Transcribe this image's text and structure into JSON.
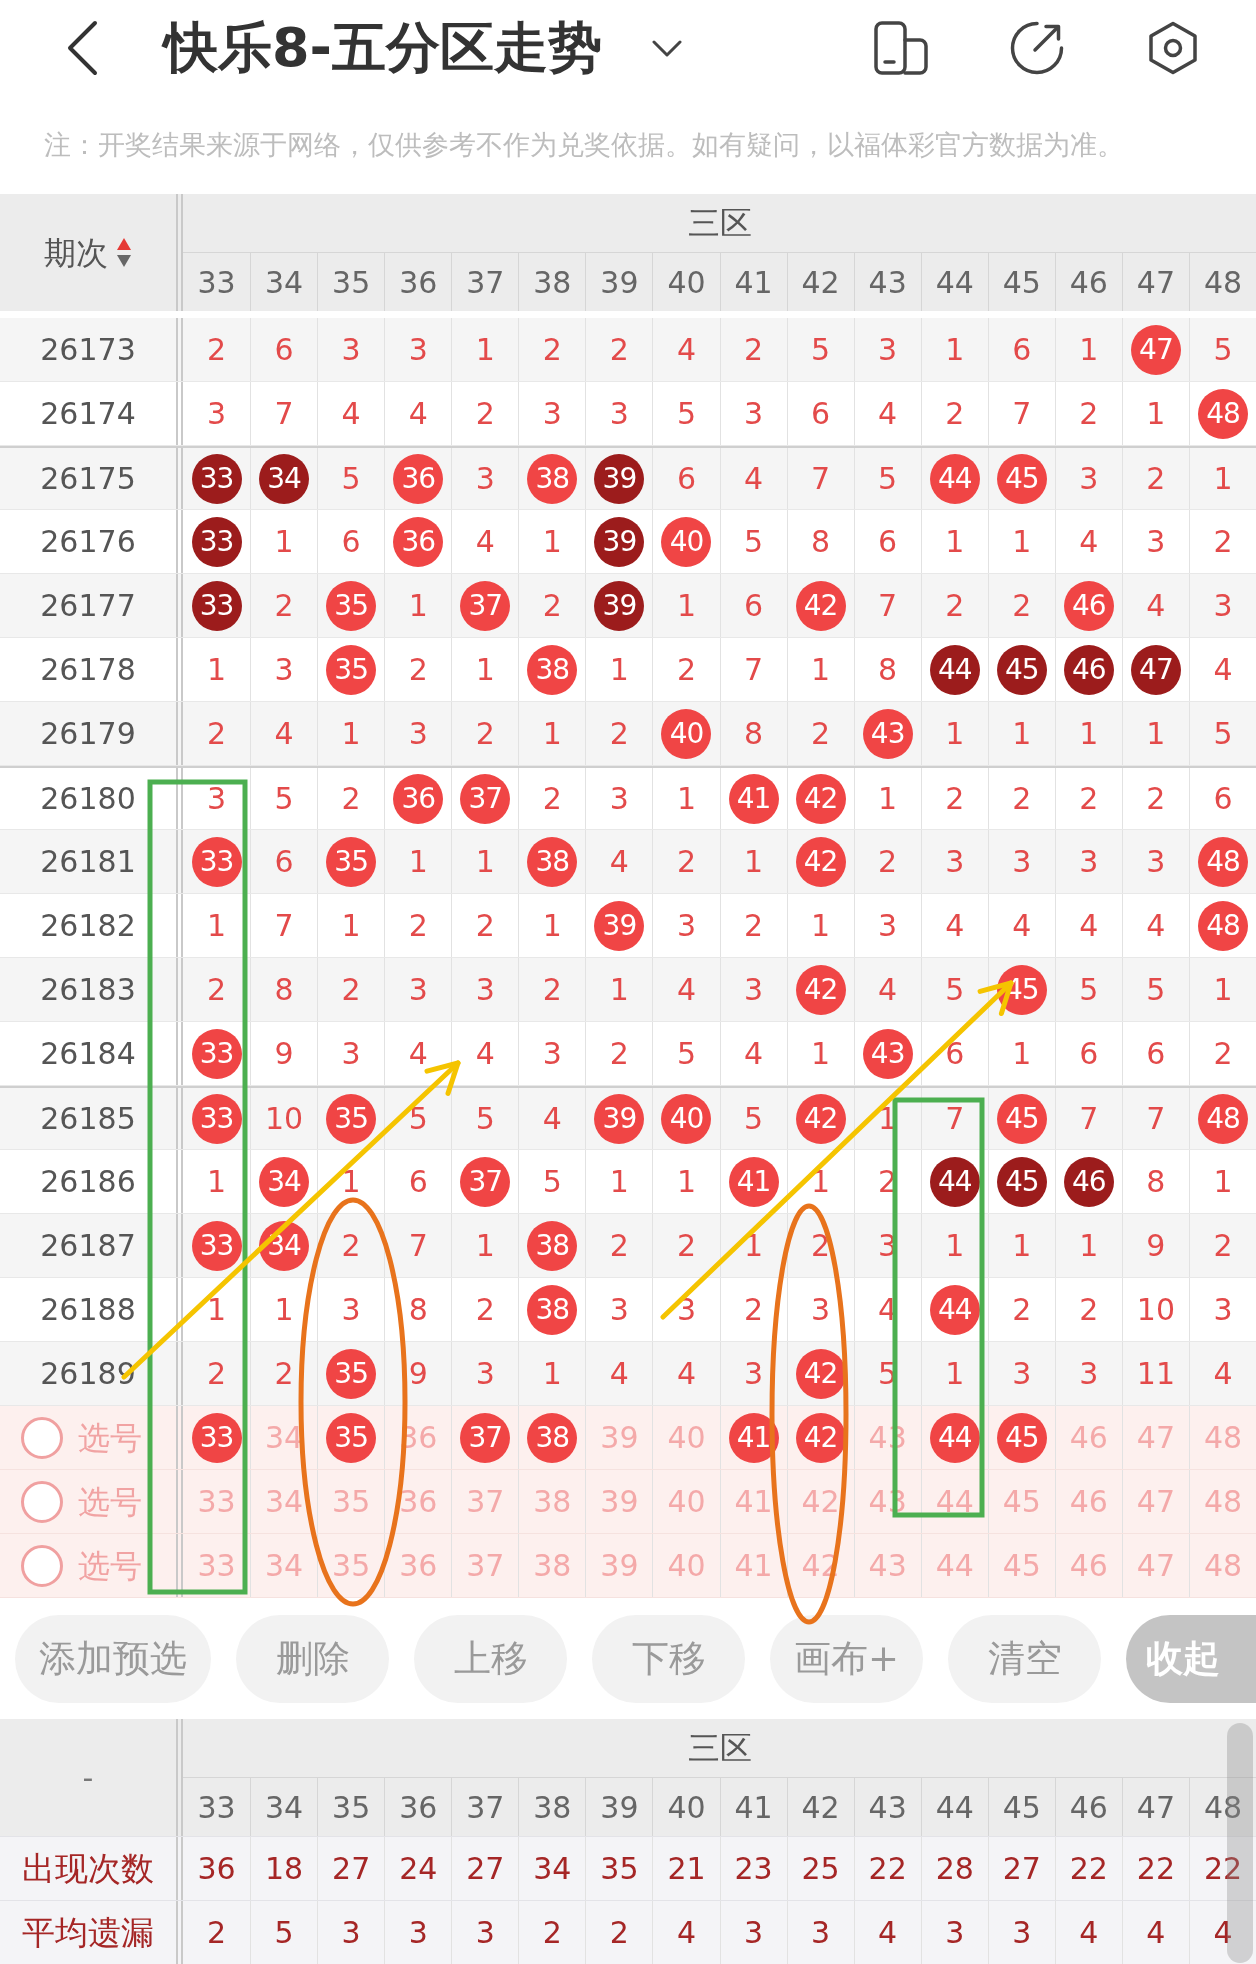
{
  "header": {
    "title": "快乐8-五分区走势"
  },
  "notice": "注：开奖结果来源于网络，仅供参考不作为兑奖依据。如有疑问，以福体彩官方数据为准。",
  "trend_table": {
    "period_header": "期次",
    "zone_label": "三区",
    "columns": [
      "33",
      "34",
      "35",
      "36",
      "37",
      "38",
      "39",
      "40",
      "41",
      "42",
      "43",
      "44",
      "45",
      "46",
      "47",
      "48"
    ],
    "rows": [
      {
        "period": "26173",
        "cells": [
          {
            "text": "2",
            "kind": "miss"
          },
          {
            "text": "6",
            "kind": "miss"
          },
          {
            "text": "3",
            "kind": "miss"
          },
          {
            "text": "3",
            "kind": "miss"
          },
          {
            "text": "1",
            "kind": "miss"
          },
          {
            "text": "2",
            "kind": "miss"
          },
          {
            "text": "2",
            "kind": "miss"
          },
          {
            "text": "4",
            "kind": "miss"
          },
          {
            "text": "2",
            "kind": "miss"
          },
          {
            "text": "5",
            "kind": "miss"
          },
          {
            "text": "3",
            "kind": "miss"
          },
          {
            "text": "1",
            "kind": "miss"
          },
          {
            "text": "6",
            "kind": "miss"
          },
          {
            "text": "1",
            "kind": "miss"
          },
          {
            "text": "47",
            "kind": "ball"
          },
          {
            "text": "5",
            "kind": "miss"
          }
        ]
      },
      {
        "period": "26174",
        "cells": [
          {
            "text": "3",
            "kind": "miss"
          },
          {
            "text": "7",
            "kind": "miss"
          },
          {
            "text": "4",
            "kind": "miss"
          },
          {
            "text": "4",
            "kind": "miss"
          },
          {
            "text": "2",
            "kind": "miss"
          },
          {
            "text": "3",
            "kind": "miss"
          },
          {
            "text": "3",
            "kind": "miss"
          },
          {
            "text": "5",
            "kind": "miss"
          },
          {
            "text": "3",
            "kind": "miss"
          },
          {
            "text": "6",
            "kind": "miss"
          },
          {
            "text": "4",
            "kind": "miss"
          },
          {
            "text": "2",
            "kind": "miss"
          },
          {
            "text": "7",
            "kind": "miss"
          },
          {
            "text": "2",
            "kind": "miss"
          },
          {
            "text": "1",
            "kind": "miss"
          },
          {
            "text": "48",
            "kind": "ball"
          }
        ]
      },
      {
        "period": "26175",
        "cells": [
          {
            "text": "33",
            "kind": "darkball"
          },
          {
            "text": "34",
            "kind": "darkball"
          },
          {
            "text": "5",
            "kind": "miss"
          },
          {
            "text": "36",
            "kind": "ball"
          },
          {
            "text": "3",
            "kind": "miss"
          },
          {
            "text": "38",
            "kind": "ball"
          },
          {
            "text": "39",
            "kind": "darkball"
          },
          {
            "text": "6",
            "kind": "miss"
          },
          {
            "text": "4",
            "kind": "miss"
          },
          {
            "text": "7",
            "kind": "miss"
          },
          {
            "text": "5",
            "kind": "miss"
          },
          {
            "text": "44",
            "kind": "ball"
          },
          {
            "text": "45",
            "kind": "ball"
          },
          {
            "text": "3",
            "kind": "miss"
          },
          {
            "text": "2",
            "kind": "miss"
          },
          {
            "text": "1",
            "kind": "miss"
          }
        ]
      },
      {
        "period": "26176",
        "cells": [
          {
            "text": "33",
            "kind": "darkball"
          },
          {
            "text": "1",
            "kind": "miss"
          },
          {
            "text": "6",
            "kind": "miss"
          },
          {
            "text": "36",
            "kind": "ball"
          },
          {
            "text": "4",
            "kind": "miss"
          },
          {
            "text": "1",
            "kind": "miss"
          },
          {
            "text": "39",
            "kind": "darkball"
          },
          {
            "text": "40",
            "kind": "ball"
          },
          {
            "text": "5",
            "kind": "miss"
          },
          {
            "text": "8",
            "kind": "miss"
          },
          {
            "text": "6",
            "kind": "miss"
          },
          {
            "text": "1",
            "kind": "miss"
          },
          {
            "text": "1",
            "kind": "miss"
          },
          {
            "text": "4",
            "kind": "miss"
          },
          {
            "text": "3",
            "kind": "miss"
          },
          {
            "text": "2",
            "kind": "miss"
          }
        ]
      },
      {
        "period": "26177",
        "cells": [
          {
            "text": "33",
            "kind": "darkball"
          },
          {
            "text": "2",
            "kind": "miss"
          },
          {
            "text": "35",
            "kind": "ball"
          },
          {
            "text": "1",
            "kind": "miss"
          },
          {
            "text": "37",
            "kind": "ball"
          },
          {
            "text": "2",
            "kind": "miss"
          },
          {
            "text": "39",
            "kind": "darkball"
          },
          {
            "text": "1",
            "kind": "miss"
          },
          {
            "text": "6",
            "kind": "miss"
          },
          {
            "text": "42",
            "kind": "ball"
          },
          {
            "text": "7",
            "kind": "miss"
          },
          {
            "text": "2",
            "kind": "miss"
          },
          {
            "text": "2",
            "kind": "miss"
          },
          {
            "text": "46",
            "kind": "ball"
          },
          {
            "text": "4",
            "kind": "miss"
          },
          {
            "text": "3",
            "kind": "miss"
          }
        ]
      },
      {
        "period": "26178",
        "cells": [
          {
            "text": "1",
            "kind": "miss"
          },
          {
            "text": "3",
            "kind": "miss"
          },
          {
            "text": "35",
            "kind": "ball"
          },
          {
            "text": "2",
            "kind": "miss"
          },
          {
            "text": "1",
            "kind": "miss"
          },
          {
            "text": "38",
            "kind": "ball"
          },
          {
            "text": "1",
            "kind": "miss"
          },
          {
            "text": "2",
            "kind": "miss"
          },
          {
            "text": "7",
            "kind": "miss"
          },
          {
            "text": "1",
            "kind": "miss"
          },
          {
            "text": "8",
            "kind": "miss"
          },
          {
            "text": "44",
            "kind": "darkball"
          },
          {
            "text": "45",
            "kind": "darkball"
          },
          {
            "text": "46",
            "kind": "darkball"
          },
          {
            "text": "47",
            "kind": "darkball"
          },
          {
            "text": "4",
            "kind": "miss"
          }
        ]
      },
      {
        "period": "26179",
        "cells": [
          {
            "text": "2",
            "kind": "miss"
          },
          {
            "text": "4",
            "kind": "miss"
          },
          {
            "text": "1",
            "kind": "miss"
          },
          {
            "text": "3",
            "kind": "miss"
          },
          {
            "text": "2",
            "kind": "miss"
          },
          {
            "text": "1",
            "kind": "miss"
          },
          {
            "text": "2",
            "kind": "miss"
          },
          {
            "text": "40",
            "kind": "ball"
          },
          {
            "text": "8",
            "kind": "miss"
          },
          {
            "text": "2",
            "kind": "miss"
          },
          {
            "text": "43",
            "kind": "ball"
          },
          {
            "text": "1",
            "kind": "miss"
          },
          {
            "text": "1",
            "kind": "miss"
          },
          {
            "text": "1",
            "kind": "miss"
          },
          {
            "text": "1",
            "kind": "miss"
          },
          {
            "text": "5",
            "kind": "miss"
          }
        ]
      },
      {
        "period": "26180",
        "cells": [
          {
            "text": "3",
            "kind": "miss"
          },
          {
            "text": "5",
            "kind": "miss"
          },
          {
            "text": "2",
            "kind": "miss"
          },
          {
            "text": "36",
            "kind": "ball"
          },
          {
            "text": "37",
            "kind": "ball"
          },
          {
            "text": "2",
            "kind": "miss"
          },
          {
            "text": "3",
            "kind": "miss"
          },
          {
            "text": "1",
            "kind": "miss"
          },
          {
            "text": "41",
            "kind": "ball"
          },
          {
            "text": "42",
            "kind": "ball"
          },
          {
            "text": "1",
            "kind": "miss"
          },
          {
            "text": "2",
            "kind": "miss"
          },
          {
            "text": "2",
            "kind": "miss"
          },
          {
            "text": "2",
            "kind": "miss"
          },
          {
            "text": "2",
            "kind": "miss"
          },
          {
            "text": "6",
            "kind": "miss"
          }
        ]
      },
      {
        "period": "26181",
        "cells": [
          {
            "text": "33",
            "kind": "ball"
          },
          {
            "text": "6",
            "kind": "miss"
          },
          {
            "text": "35",
            "kind": "ball"
          },
          {
            "text": "1",
            "kind": "miss"
          },
          {
            "text": "1",
            "kind": "miss"
          },
          {
            "text": "38",
            "kind": "ball"
          },
          {
            "text": "4",
            "kind": "miss"
          },
          {
            "text": "2",
            "kind": "miss"
          },
          {
            "text": "1",
            "kind": "miss"
          },
          {
            "text": "42",
            "kind": "ball"
          },
          {
            "text": "2",
            "kind": "miss"
          },
          {
            "text": "3",
            "kind": "miss"
          },
          {
            "text": "3",
            "kind": "miss"
          },
          {
            "text": "3",
            "kind": "miss"
          },
          {
            "text": "3",
            "kind": "miss"
          },
          {
            "text": "48",
            "kind": "ball"
          }
        ]
      },
      {
        "period": "26182",
        "cells": [
          {
            "text": "1",
            "kind": "miss"
          },
          {
            "text": "7",
            "kind": "miss"
          },
          {
            "text": "1",
            "kind": "miss"
          },
          {
            "text": "2",
            "kind": "miss"
          },
          {
            "text": "2",
            "kind": "miss"
          },
          {
            "text": "1",
            "kind": "miss"
          },
          {
            "text": "39",
            "kind": "ball"
          },
          {
            "text": "3",
            "kind": "miss"
          },
          {
            "text": "2",
            "kind": "miss"
          },
          {
            "text": "1",
            "kind": "miss"
          },
          {
            "text": "3",
            "kind": "miss"
          },
          {
            "text": "4",
            "kind": "miss"
          },
          {
            "text": "4",
            "kind": "miss"
          },
          {
            "text": "4",
            "kind": "miss"
          },
          {
            "text": "4",
            "kind": "miss"
          },
          {
            "text": "48",
            "kind": "ball"
          }
        ]
      },
      {
        "period": "26183",
        "cells": [
          {
            "text": "2",
            "kind": "miss"
          },
          {
            "text": "8",
            "kind": "miss"
          },
          {
            "text": "2",
            "kind": "miss"
          },
          {
            "text": "3",
            "kind": "miss"
          },
          {
            "text": "3",
            "kind": "miss"
          },
          {
            "text": "2",
            "kind": "miss"
          },
          {
            "text": "1",
            "kind": "miss"
          },
          {
            "text": "4",
            "kind": "miss"
          },
          {
            "text": "3",
            "kind": "miss"
          },
          {
            "text": "42",
            "kind": "ball"
          },
          {
            "text": "4",
            "kind": "miss"
          },
          {
            "text": "5",
            "kind": "miss"
          },
          {
            "text": "45",
            "kind": "ball"
          },
          {
            "text": "5",
            "kind": "miss"
          },
          {
            "text": "5",
            "kind": "miss"
          },
          {
            "text": "1",
            "kind": "miss"
          }
        ]
      },
      {
        "period": "26184",
        "cells": [
          {
            "text": "33",
            "kind": "ball"
          },
          {
            "text": "9",
            "kind": "miss"
          },
          {
            "text": "3",
            "kind": "miss"
          },
          {
            "text": "4",
            "kind": "miss"
          },
          {
            "text": "4",
            "kind": "miss"
          },
          {
            "text": "3",
            "kind": "miss"
          },
          {
            "text": "2",
            "kind": "miss"
          },
          {
            "text": "5",
            "kind": "miss"
          },
          {
            "text": "4",
            "kind": "miss"
          },
          {
            "text": "1",
            "kind": "miss"
          },
          {
            "text": "43",
            "kind": "ball"
          },
          {
            "text": "6",
            "kind": "miss"
          },
          {
            "text": "1",
            "kind": "miss"
          },
          {
            "text": "6",
            "kind": "miss"
          },
          {
            "text": "6",
            "kind": "miss"
          },
          {
            "text": "2",
            "kind": "miss"
          }
        ]
      },
      {
        "period": "26185",
        "cells": [
          {
            "text": "33",
            "kind": "ball"
          },
          {
            "text": "10",
            "kind": "miss"
          },
          {
            "text": "35",
            "kind": "ball"
          },
          {
            "text": "5",
            "kind": "miss"
          },
          {
            "text": "5",
            "kind": "miss"
          },
          {
            "text": "4",
            "kind": "miss"
          },
          {
            "text": "39",
            "kind": "ball"
          },
          {
            "text": "40",
            "kind": "ball"
          },
          {
            "text": "5",
            "kind": "miss"
          },
          {
            "text": "42",
            "kind": "ball"
          },
          {
            "text": "1",
            "kind": "miss"
          },
          {
            "text": "7",
            "kind": "miss"
          },
          {
            "text": "45",
            "kind": "ball"
          },
          {
            "text": "7",
            "kind": "miss"
          },
          {
            "text": "7",
            "kind": "miss"
          },
          {
            "text": "48",
            "kind": "ball"
          }
        ]
      },
      {
        "period": "26186",
        "cells": [
          {
            "text": "1",
            "kind": "miss"
          },
          {
            "text": "34",
            "kind": "ball"
          },
          {
            "text": "1",
            "kind": "miss"
          },
          {
            "text": "6",
            "kind": "miss"
          },
          {
            "text": "37",
            "kind": "ball"
          },
          {
            "text": "5",
            "kind": "miss"
          },
          {
            "text": "1",
            "kind": "miss"
          },
          {
            "text": "1",
            "kind": "miss"
          },
          {
            "text": "41",
            "kind": "ball"
          },
          {
            "text": "1",
            "kind": "miss"
          },
          {
            "text": "2",
            "kind": "miss"
          },
          {
            "text": "44",
            "kind": "darkball"
          },
          {
            "text": "45",
            "kind": "darkball"
          },
          {
            "text": "46",
            "kind": "darkball"
          },
          {
            "text": "8",
            "kind": "miss"
          },
          {
            "text": "1",
            "kind": "miss"
          }
        ]
      },
      {
        "period": "26187",
        "cells": [
          {
            "text": "33",
            "kind": "ball"
          },
          {
            "text": "34",
            "kind": "ball"
          },
          {
            "text": "2",
            "kind": "miss"
          },
          {
            "text": "7",
            "kind": "miss"
          },
          {
            "text": "1",
            "kind": "miss"
          },
          {
            "text": "38",
            "kind": "ball"
          },
          {
            "text": "2",
            "kind": "miss"
          },
          {
            "text": "2",
            "kind": "miss"
          },
          {
            "text": "1",
            "kind": "miss"
          },
          {
            "text": "2",
            "kind": "miss"
          },
          {
            "text": "3",
            "kind": "miss"
          },
          {
            "text": "1",
            "kind": "miss"
          },
          {
            "text": "1",
            "kind": "miss"
          },
          {
            "text": "1",
            "kind": "miss"
          },
          {
            "text": "9",
            "kind": "miss"
          },
          {
            "text": "2",
            "kind": "miss"
          }
        ]
      },
      {
        "period": "26188",
        "cells": [
          {
            "text": "1",
            "kind": "miss"
          },
          {
            "text": "1",
            "kind": "miss"
          },
          {
            "text": "3",
            "kind": "miss"
          },
          {
            "text": "8",
            "kind": "miss"
          },
          {
            "text": "2",
            "kind": "miss"
          },
          {
            "text": "38",
            "kind": "ball"
          },
          {
            "text": "3",
            "kind": "miss"
          },
          {
            "text": "3",
            "kind": "miss"
          },
          {
            "text": "2",
            "kind": "miss"
          },
          {
            "text": "3",
            "kind": "miss"
          },
          {
            "text": "4",
            "kind": "miss"
          },
          {
            "text": "44",
            "kind": "ball"
          },
          {
            "text": "2",
            "kind": "miss"
          },
          {
            "text": "2",
            "kind": "miss"
          },
          {
            "text": "10",
            "kind": "miss"
          },
          {
            "text": "3",
            "kind": "miss"
          }
        ]
      },
      {
        "period": "26189",
        "cells": [
          {
            "text": "2",
            "kind": "miss"
          },
          {
            "text": "2",
            "kind": "miss"
          },
          {
            "text": "35",
            "kind": "ball"
          },
          {
            "text": "9",
            "kind": "miss"
          },
          {
            "text": "3",
            "kind": "miss"
          },
          {
            "text": "1",
            "kind": "miss"
          },
          {
            "text": "4",
            "kind": "miss"
          },
          {
            "text": "4",
            "kind": "miss"
          },
          {
            "text": "3",
            "kind": "miss"
          },
          {
            "text": "42",
            "kind": "ball"
          },
          {
            "text": "5",
            "kind": "miss"
          },
          {
            "text": "1",
            "kind": "miss"
          },
          {
            "text": "3",
            "kind": "miss"
          },
          {
            "text": "3",
            "kind": "miss"
          },
          {
            "text": "11",
            "kind": "miss"
          },
          {
            "text": "4",
            "kind": "miss"
          }
        ]
      }
    ],
    "pick_rows": [
      {
        "label": "选号",
        "checked": false,
        "cells": [
          {
            "text": "33",
            "selected": true
          },
          {
            "text": "34",
            "selected": false
          },
          {
            "text": "35",
            "selected": true
          },
          {
            "text": "36",
            "selected": false
          },
          {
            "text": "37",
            "selected": true
          },
          {
            "text": "38",
            "selected": true
          },
          {
            "text": "39",
            "selected": false
          },
          {
            "text": "40",
            "selected": false
          },
          {
            "text": "41",
            "selected": true
          },
          {
            "text": "42",
            "selected": true
          },
          {
            "text": "43",
            "selected": false
          },
          {
            "text": "44",
            "selected": true
          },
          {
            "text": "45",
            "selected": true
          },
          {
            "text": "46",
            "selected": false
          },
          {
            "text": "47",
            "selected": false
          },
          {
            "text": "48",
            "selected": false
          }
        ]
      },
      {
        "label": "选号",
        "checked": false,
        "cells": [
          {
            "text": "33",
            "selected": false
          },
          {
            "text": "34",
            "selected": false
          },
          {
            "text": "35",
            "selected": false
          },
          {
            "text": "36",
            "selected": false
          },
          {
            "text": "37",
            "selected": false
          },
          {
            "text": "38",
            "selected": false
          },
          {
            "text": "39",
            "selected": false
          },
          {
            "text": "40",
            "selected": false
          },
          {
            "text": "41",
            "selected": false
          },
          {
            "text": "42",
            "selected": false
          },
          {
            "text": "43",
            "selected": false
          },
          {
            "text": "44",
            "selected": false
          },
          {
            "text": "45",
            "selected": false
          },
          {
            "text": "46",
            "selected": false
          },
          {
            "text": "47",
            "selected": false
          },
          {
            "text": "48",
            "selected": false
          }
        ]
      },
      {
        "label": "选号",
        "checked": false,
        "cells": [
          {
            "text": "33",
            "selected": false
          },
          {
            "text": "34",
            "selected": false
          },
          {
            "text": "35",
            "selected": false
          },
          {
            "text": "36",
            "selected": false
          },
          {
            "text": "37",
            "selected": false
          },
          {
            "text": "38",
            "selected": false
          },
          {
            "text": "39",
            "selected": false
          },
          {
            "text": "40",
            "selected": false
          },
          {
            "text": "41",
            "selected": false
          },
          {
            "text": "42",
            "selected": false
          },
          {
            "text": "43",
            "selected": false
          },
          {
            "text": "44",
            "selected": false
          },
          {
            "text": "45",
            "selected": false
          },
          {
            "text": "46",
            "selected": false
          },
          {
            "text": "47",
            "selected": false
          },
          {
            "text": "48",
            "selected": false
          }
        ]
      }
    ]
  },
  "toolbar": [
    {
      "label": "添加预选",
      "kind": "plain"
    },
    {
      "label": "删除",
      "kind": "plain"
    },
    {
      "label": "上移",
      "kind": "plain"
    },
    {
      "label": "下移",
      "kind": "plain"
    },
    {
      "label": "画布+",
      "kind": "plain"
    },
    {
      "label": "清空",
      "kind": "plain"
    },
    {
      "label": "收起",
      "kind": "filled"
    }
  ],
  "stats_table": {
    "corner": "-",
    "zone_label": "三区",
    "columns": [
      "33",
      "34",
      "35",
      "36",
      "37",
      "38",
      "39",
      "40",
      "41",
      "42",
      "43",
      "44",
      "45",
      "46",
      "47",
      "48"
    ],
    "rows": [
      {
        "label": "出现次数",
        "values": [
          "36",
          "18",
          "27",
          "24",
          "27",
          "34",
          "35",
          "21",
          "23",
          "25",
          "22",
          "28",
          "27",
          "22",
          "22",
          "22"
        ]
      },
      {
        "label": "平均遗漏",
        "values": [
          "2",
          "5",
          "3",
          "3",
          "3",
          "2",
          "2",
          "4",
          "3",
          "3",
          "4",
          "3",
          "3",
          "4",
          "4",
          "4"
        ]
      }
    ]
  },
  "annotations": [
    {
      "kind": "rectangle",
      "color": "#4caf50"
    },
    {
      "kind": "rectangle",
      "color": "#4caf50"
    },
    {
      "kind": "ellipse",
      "color": "#e8731c"
    },
    {
      "kind": "ellipse",
      "color": "#e8731c"
    },
    {
      "kind": "arrow",
      "color": "#f5c400"
    },
    {
      "kind": "arrow",
      "color": "#f5c400"
    }
  ]
}
